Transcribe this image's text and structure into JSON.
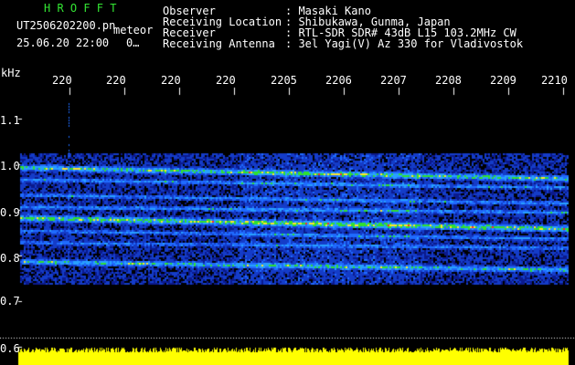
{
  "title": "H R O F F T",
  "file_name": "UT2506202200.pn",
  "tag": "meteor",
  "datetime": "25.06.20 22:00",
  "counter": "0…",
  "header": {
    "labels": [
      "Observer",
      "Receiving Location",
      "Receiver",
      "Receiving Antenna"
    ],
    "values": [
      ": Masaki Kano",
      ": Shibukawa, Gunma, Japan",
      ": RTL-SDR SDR# 43dB L15 103.2MHz CW",
      ": 3el Yagi(V) Az 330 for Vladivostok"
    ]
  },
  "axis": {
    "y_unit": "kHz",
    "y_ticks": [
      "1.1",
      "1.0",
      "0.9",
      "0.8",
      "0.7",
      "0.6"
    ],
    "x_ticks": [
      "220",
      "220",
      "220",
      "220",
      "2205",
      "2206",
      "2207",
      "2208",
      "2209",
      "2210"
    ]
  },
  "colors": {
    "background": "#000000",
    "text": "#ffffff",
    "title": "#33e633",
    "noise_low": "#0b1a8c",
    "noise_mid": "#1f6bff",
    "signal_high": "#ff2a2a",
    "signal_green": "#2fe02f",
    "bottom_bar": "#ffff00"
  }
}
